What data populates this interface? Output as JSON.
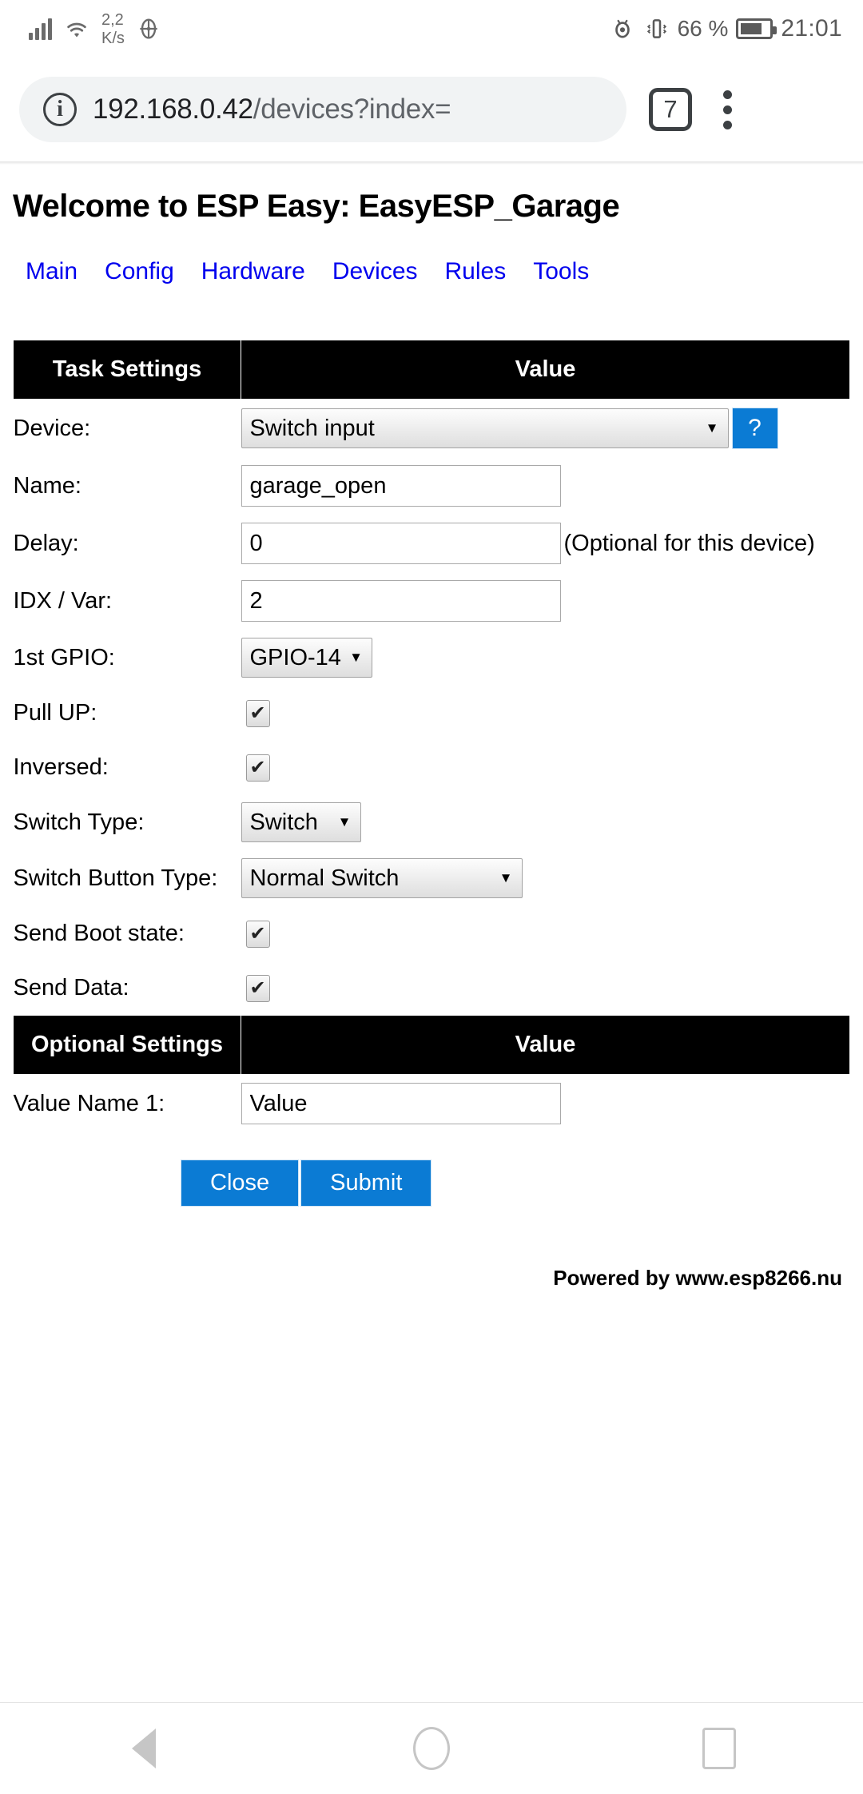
{
  "statusbar": {
    "network_speed_value": "2,2",
    "network_speed_unit": "K/s",
    "battery_percent": "66 %",
    "clock": "21:01",
    "icons": [
      "signal-bars-icon",
      "wifi-icon",
      "location-icon",
      "eye-care-icon",
      "vibrate-icon",
      "battery-icon"
    ]
  },
  "browser": {
    "url_host": "192.168.0.42",
    "url_path": "/devices?index=",
    "tab_count": "7",
    "security_icon": "info-icon",
    "menu_icon": "overflow-menu-icon"
  },
  "page": {
    "title": "Welcome to ESP Easy: EasyESP_Garage",
    "nav": [
      {
        "label": "Main"
      },
      {
        "label": "Config"
      },
      {
        "label": "Hardware"
      },
      {
        "label": "Devices"
      },
      {
        "label": "Rules"
      },
      {
        "label": "Tools"
      }
    ],
    "task_table": {
      "header_left": "Task Settings",
      "header_right": "Value",
      "rows": {
        "device": {
          "label": "Device:",
          "value": "Switch input",
          "help": "?"
        },
        "name": {
          "label": "Name:",
          "value": "garage_open"
        },
        "delay": {
          "label": "Delay:",
          "value": "0",
          "hint": "(Optional for this device)"
        },
        "idx": {
          "label": "IDX / Var:",
          "value": "2"
        },
        "gpio": {
          "label": "1st GPIO:",
          "value": "GPIO-14"
        },
        "pullup": {
          "label": "Pull UP:",
          "checked": "✔"
        },
        "inversed": {
          "label": "Inversed:",
          "checked": "✔"
        },
        "switch_type": {
          "label": "Switch Type:",
          "value": "Switch"
        },
        "switch_button_type": {
          "label": "Switch Button Type:",
          "value": "Normal Switch"
        },
        "send_boot_state": {
          "label": "Send Boot state:",
          "checked": "✔"
        },
        "send_data": {
          "label": "Send Data:",
          "checked": "✔"
        }
      }
    },
    "optional_table": {
      "header_left": "Optional Settings",
      "header_right": "Value",
      "value_name_1": {
        "label": "Value Name 1:",
        "value": "Value"
      }
    },
    "buttons": {
      "close": "Close",
      "submit": "Submit"
    },
    "footer": "Powered by www.esp8266.nu"
  },
  "android_nav": {
    "back": "back-icon",
    "home": "home-icon",
    "recents": "recents-icon"
  },
  "colors": {
    "link": "#0000EE",
    "accent_blue": "#0b7bd4",
    "header_black": "#000000",
    "omnibox_bg": "#f1f3f4"
  }
}
